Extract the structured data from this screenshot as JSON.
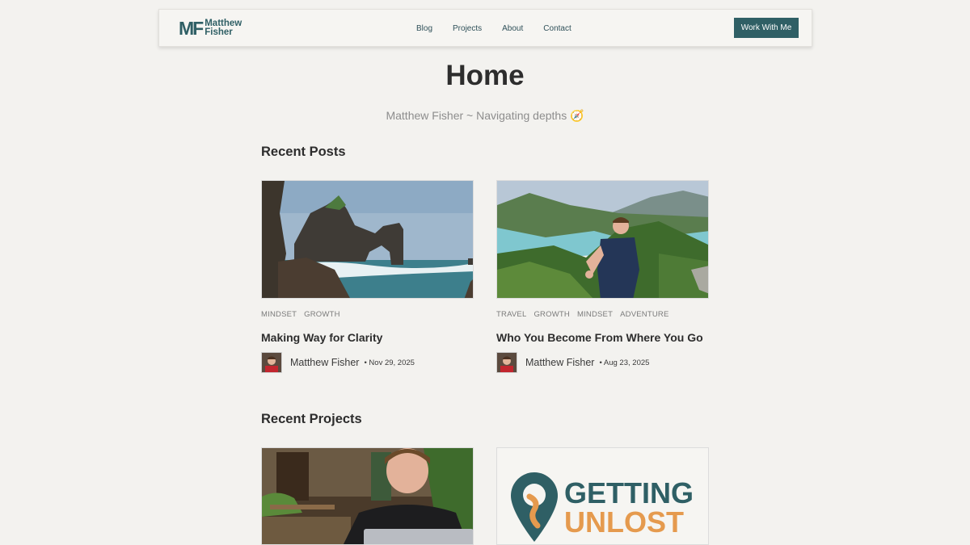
{
  "header": {
    "logo_mark": "MF",
    "logo_line1": "Matthew",
    "logo_line2": "Fisher",
    "nav": [
      {
        "label": "Blog"
      },
      {
        "label": "Projects"
      },
      {
        "label": "About"
      },
      {
        "label": "Contact"
      }
    ],
    "cta_label": "Work With Me"
  },
  "hero": {
    "title": "Home",
    "subtitle": "Matthew Fisher ~ Navigating depths",
    "subtitle_emoji": "🧭"
  },
  "recent_posts": {
    "heading": "Recent Posts",
    "posts": [
      {
        "tags": [
          "MINDSET",
          "GROWTH"
        ],
        "title": "Making Way for Clarity",
        "author": "Matthew Fisher",
        "date": "• Nov 29, 2025",
        "image": "sea-arch-photo"
      },
      {
        "tags": [
          "TRAVEL",
          "GROWTH",
          "MINDSET",
          "ADVENTURE"
        ],
        "title": "Who You Become From Where You Go",
        "author": "Matthew Fisher",
        "date": "• Aug 23, 2025",
        "image": "hilltop-thumbs-up-photo"
      }
    ]
  },
  "recent_projects": {
    "heading": "Recent Projects",
    "projects": [
      {
        "image": "laptop-cafe-photo"
      },
      {
        "image": "getting-unlost-logo",
        "logo_line1": "GETTING",
        "logo_line2": "UNLOST"
      }
    ]
  },
  "colors": {
    "background": "#f3f2ef",
    "accent": "#2f5f65",
    "logo_orange": "#e59a4e"
  }
}
